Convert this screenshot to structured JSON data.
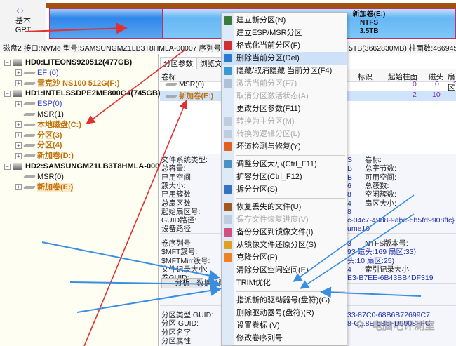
{
  "nav": {
    "back": "‹",
    "forward": "›"
  },
  "disk_type": {
    "line1": "基本",
    "line2": "GPT"
  },
  "disk_map": {
    "partition_name": "新加卷(E:)",
    "fs": "NTFS",
    "size": "3.5TB"
  },
  "info_line": {
    "left": "磁盘2 接口:NVMe  型号:SAMSUNGMZ1LB3T8HMLA-00007  序列号:3",
    "right": "5TB(3662830MB)  柱面数:466945"
  },
  "tree": [
    {
      "label": "HD0:LITEONS920512(477GB)",
      "type": "disk"
    },
    {
      "label": "EFI(0)",
      "type": "part",
      "style": "blue"
    },
    {
      "label": "雷克沙 NS100 512G(F:)",
      "type": "part",
      "style": "orange"
    },
    {
      "label": "HD1:INTELSSDPE2ME800G4(745GB)",
      "type": "disk"
    },
    {
      "label": "ESP(0)",
      "type": "part",
      "style": "blue"
    },
    {
      "label": "MSR(1)",
      "type": "part",
      "style": "plain"
    },
    {
      "label": "本地磁盘(C:)",
      "type": "part",
      "style": "orange"
    },
    {
      "label": "分区(3)",
      "type": "part",
      "style": "orange"
    },
    {
      "label": "分区(4)",
      "type": "part",
      "style": "orange"
    },
    {
      "label": "新加卷(D:)",
      "type": "part",
      "style": "orange"
    },
    {
      "label": "HD2:SAMSUNGMZ1LB3T8HMLA-00007",
      "type": "disk"
    },
    {
      "label": "MSR(0)",
      "type": "part",
      "style": "plain"
    },
    {
      "label": "新加卷(E:)",
      "type": "part",
      "style": "orange"
    }
  ],
  "tabs": [
    "分区参数",
    "浏览文件"
  ],
  "table": {
    "headers": [
      "卷标",
      "标识",
      "起始柱面",
      "磁头",
      "扇区"
    ],
    "rows": [
      {
        "label": "MSR(0)",
        "start_cyl": "0",
        "head": "0",
        "sector": "3"
      },
      {
        "label": "新加卷(E:)",
        "start_cyl": "2",
        "head": "10",
        "sector": ""
      }
    ]
  },
  "details": {
    "labels_a": [
      "文件系统类型:",
      "总容量:",
      "已用空间:",
      "簇大小:",
      "已用簇数:",
      "总扇区数:",
      "起始扇区号:",
      "GUID路径:",
      "设备路径:"
    ],
    "values_a": [
      "S",
      "B",
      "B",
      "6",
      "8",
      "4",
      "8",
      "c-04c7-4988-9abe-5b5fd9908ffc}",
      "ume10"
    ],
    "labels_b": [
      "卷标:",
      "总字节数:",
      "可用空间:",
      "总簇数:",
      "空闲簇数:",
      "扇区大小:"
    ],
    "labels_c": [
      "卷序列号:",
      "$MFT簇号:",
      "$MFTMirr簇号:",
      "文件记录大小:",
      "卷GUID:"
    ],
    "values_c": [
      "3",
      "93 磁头:169 扇区:33)",
      "头:10 扇区:25)",
      "4",
      "E3-B7EE-6B43BB4DF319"
    ],
    "labels_d": [
      "NTFS版本号:",
      "索引记录大小:"
    ],
    "analyze_button": "分析",
    "data_dist": "数据分配",
    "labels_e": [
      "分区类型 GUID:",
      "分区 GUID:",
      "分区名字:",
      "分区属性:"
    ],
    "values_e": [
      "33-87C0-68B6B72699C7",
      "8-C...8E-5B5FD9908FFC"
    ]
  },
  "context_menu": [
    {
      "label": "建立新分区(N)",
      "icon": "new-partition-icon",
      "color": "#3a7a3a"
    },
    {
      "label": "建立ESP/MSR分区"
    },
    {
      "label": "格式化当前分区(F)",
      "icon": "format-icon",
      "color": "#d03030"
    },
    {
      "label": "删除当前分区(Del)",
      "icon": "delete-icon",
      "color": "#2a7ad0",
      "highlight": true
    },
    {
      "label": "隐藏/取消隐藏 当前分区(F4)",
      "icon": "hide-icon",
      "color": "#3a9ad0"
    },
    {
      "label": "激活当前分区(F7)",
      "icon": "activate-icon",
      "color": "#b0c0d8",
      "disabled": true
    },
    {
      "label": "取消分区激活状态(A)",
      "disabled": true
    },
    {
      "label": "更改分区参数(F11)"
    },
    {
      "label": "转换为主分区(M)",
      "icon": "convert-primary-icon",
      "color": "#c0cce0",
      "disabled": true
    },
    {
      "label": "转换为逻辑分区(L)",
      "icon": "convert-logical-icon",
      "color": "#c0cce0",
      "disabled": true
    },
    {
      "label": "坏道检测与修复(Y)",
      "icon": "repair-tools-icon",
      "color": "#e06020"
    },
    {
      "sep": true
    },
    {
      "label": "调整分区大小(Ctrl_F11)",
      "icon": "resize-icon",
      "color": "#4a90c0"
    },
    {
      "label": "扩容分区(Ctrl_F12)"
    },
    {
      "label": "拆分分区(S)",
      "icon": "split-icon",
      "color": "#3a70c0"
    },
    {
      "sep": true
    },
    {
      "label": "恢复丢失的文件(U)",
      "icon": "recover-icon",
      "color": "#a05a20"
    },
    {
      "label": "保存文件恢复进度(V)",
      "icon": "save-icon",
      "color": "#c0cce0",
      "disabled": true
    },
    {
      "label": "备份分区到镜像文件(I)",
      "icon": "backup-icon",
      "color": "#d05080"
    },
    {
      "label": "从镜像文件还原分区(S)",
      "icon": "restore-icon",
      "color": "#e0a020"
    },
    {
      "label": "克隆分区(P)",
      "icon": "clone-icon",
      "color": "#f08020"
    },
    {
      "label": "清除分区空闲空间(E)"
    },
    {
      "label": "TRIM优化"
    },
    {
      "sep": true
    },
    {
      "label": "指派新的驱动器号(盘符)(G)"
    },
    {
      "label": "删除驱动器号(盘符)(R)"
    },
    {
      "label": "设置卷标 (V)"
    },
    {
      "label": "修改卷序列号"
    }
  ],
  "watermark": "电脑吧评测室"
}
